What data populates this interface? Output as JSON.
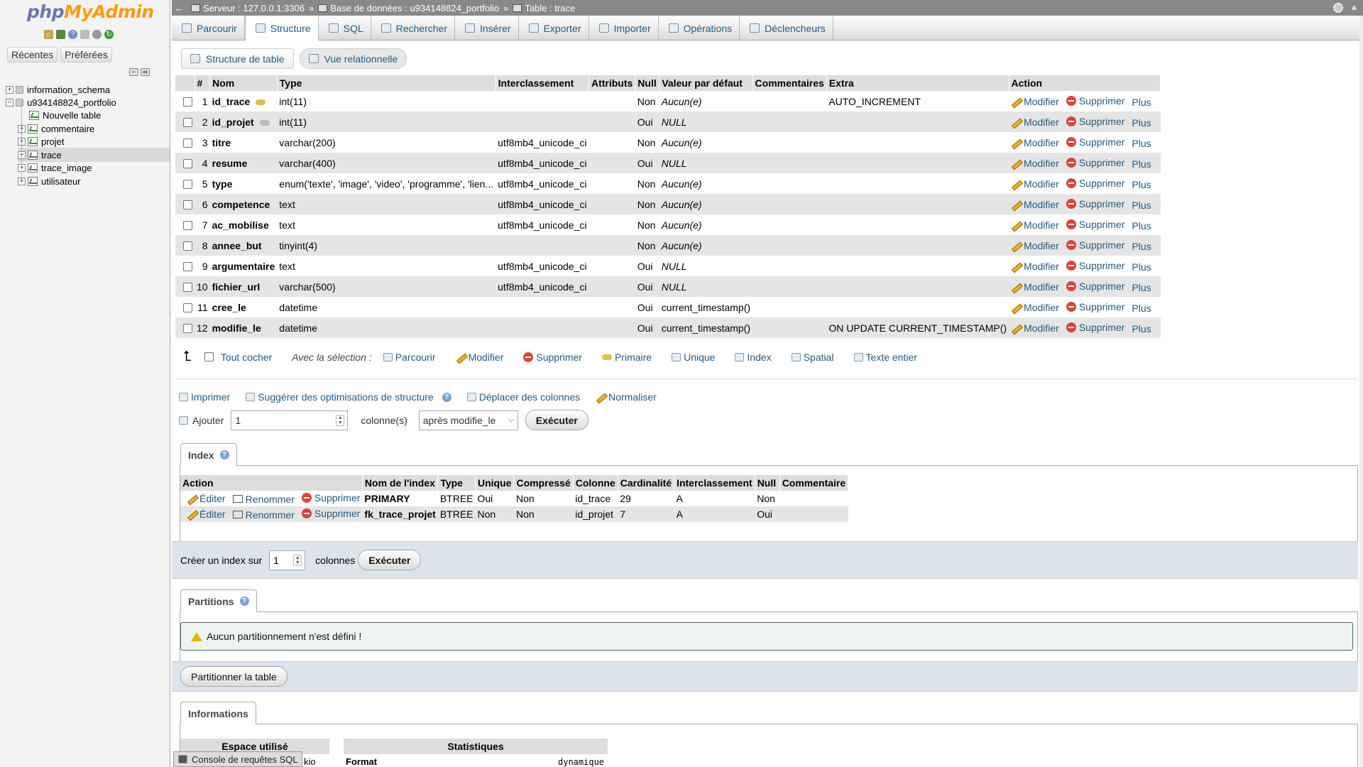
{
  "sidebar": {
    "logo_php": "php",
    "logo_my": "MyAdmin",
    "tabs": [
      "Récentes",
      "Préférées"
    ],
    "tree": [
      {
        "label": "information_schema",
        "kind": "db",
        "level": 0
      },
      {
        "label": "u934148824_portfolio",
        "kind": "db",
        "level": 0
      },
      {
        "label": "Nouvelle table",
        "kind": "new",
        "level": 1
      },
      {
        "label": "commentaire",
        "kind": "table",
        "level": 1
      },
      {
        "label": "projet",
        "kind": "table",
        "level": 1
      },
      {
        "label": "trace",
        "kind": "table",
        "level": 1
      },
      {
        "label": "trace_image",
        "kind": "table",
        "level": 1
      },
      {
        "label": "utilisateur",
        "kind": "table",
        "level": 1
      }
    ]
  },
  "breadcrumb": {
    "server": "Serveur : 127.0.0.1:3306",
    "database": "Base de données : u934148824_portfolio",
    "table": "Table : trace",
    "separator": "»"
  },
  "tabs": [
    "Parcourir",
    "Structure",
    "SQL",
    "Rechercher",
    "Insérer",
    "Exporter",
    "Importer",
    "Opérations",
    "Déclencheurs"
  ],
  "active_tab": "Structure",
  "subtabs": [
    "Structure de table",
    "Vue relationnelle"
  ],
  "structure": {
    "headers": [
      "#",
      "Nom",
      "Type",
      "Interclassement",
      "Attributs",
      "Null",
      "Valeur par défaut",
      "Commentaires",
      "Extra",
      "Action"
    ],
    "rows": [
      {
        "num": "1",
        "name": "id_trace",
        "key": "primary",
        "type": "int(11)",
        "collation": "",
        "null": "Non",
        "default": "Aucun(e)",
        "default_italic": true,
        "extra": "AUTO_INCREMENT"
      },
      {
        "num": "2",
        "name": "id_projet",
        "key": "index",
        "type": "int(11)",
        "collation": "",
        "null": "Oui",
        "default": "NULL",
        "default_italic": true,
        "extra": ""
      },
      {
        "num": "3",
        "name": "titre",
        "key": "",
        "type": "varchar(200)",
        "collation": "utf8mb4_unicode_ci",
        "null": "Non",
        "default": "Aucun(e)",
        "default_italic": true,
        "extra": ""
      },
      {
        "num": "4",
        "name": "resume",
        "key": "",
        "type": "varchar(400)",
        "collation": "utf8mb4_unicode_ci",
        "null": "Oui",
        "default": "NULL",
        "default_italic": true,
        "extra": ""
      },
      {
        "num": "5",
        "name": "type",
        "key": "",
        "type": "enum('texte', 'image', 'video', 'programme', 'lien...",
        "collation": "utf8mb4_unicode_ci",
        "null": "Non",
        "default": "Aucun(e)",
        "default_italic": true,
        "extra": ""
      },
      {
        "num": "6",
        "name": "competence",
        "key": "",
        "type": "text",
        "collation": "utf8mb4_unicode_ci",
        "null": "Non",
        "default": "Aucun(e)",
        "default_italic": true,
        "extra": ""
      },
      {
        "num": "7",
        "name": "ac_mobilise",
        "key": "",
        "type": "text",
        "collation": "utf8mb4_unicode_ci",
        "null": "Non",
        "default": "Aucun(e)",
        "default_italic": true,
        "extra": ""
      },
      {
        "num": "8",
        "name": "annee_but",
        "key": "",
        "type": "tinyint(4)",
        "collation": "",
        "null": "Non",
        "default": "Aucun(e)",
        "default_italic": true,
        "extra": ""
      },
      {
        "num": "9",
        "name": "argumentaire",
        "key": "",
        "type": "text",
        "collation": "utf8mb4_unicode_ci",
        "null": "Oui",
        "default": "NULL",
        "default_italic": true,
        "extra": ""
      },
      {
        "num": "10",
        "name": "fichier_url",
        "key": "",
        "type": "varchar(500)",
        "collation": "utf8mb4_unicode_ci",
        "null": "Oui",
        "default": "NULL",
        "default_italic": true,
        "extra": ""
      },
      {
        "num": "11",
        "name": "cree_le",
        "key": "",
        "type": "datetime",
        "collation": "",
        "null": "Oui",
        "default": "current_timestamp()",
        "default_italic": false,
        "extra": ""
      },
      {
        "num": "12",
        "name": "modifie_le",
        "key": "",
        "type": "datetime",
        "collation": "",
        "null": "Oui",
        "default": "current_timestamp()",
        "default_italic": false,
        "extra": "ON UPDATE CURRENT_TIMESTAMP()"
      }
    ],
    "actions": {
      "modify": "Modifier",
      "delete": "Supprimer",
      "more": "Plus"
    }
  },
  "selection": {
    "check_all": "Tout cocher",
    "with_selection": "Avec la sélection :",
    "actions": [
      "Parcourir",
      "Modifier",
      "Supprimer",
      "Primaire",
      "Unique",
      "Index",
      "Spatial",
      "Texte entier"
    ]
  },
  "tools": {
    "print": "Imprimer",
    "suggest": "Suggérer des optimisations de structure",
    "move": "Déplacer des colonnes",
    "normalize": "Normaliser"
  },
  "add": {
    "label": "Ajouter",
    "count": "1",
    "unit": "colonne(s)",
    "position": "après modifie_le",
    "execute": "Exécuter"
  },
  "index": {
    "legend": "Index",
    "headers": [
      "Action",
      "Nom de l'index",
      "Type",
      "Unique",
      "Compressé",
      "Colonne",
      "Cardinalité",
      "Interclassement",
      "Null",
      "Commentaire"
    ],
    "actions": {
      "edit": "Éditer",
      "rename": "Renommer",
      "delete": "Supprimer"
    },
    "rows": [
      {
        "name": "PRIMARY",
        "type": "BTREE",
        "unique": "Oui",
        "packed": "Non",
        "column": "id_trace",
        "cardinality": "29",
        "collation": "A",
        "null": "Non",
        "comment": ""
      },
      {
        "name": "fk_trace_projet",
        "type": "BTREE",
        "unique": "Non",
        "packed": "Non",
        "column": "id_projet",
        "cardinality": "7",
        "collation": "A",
        "null": "Oui",
        "comment": ""
      }
    ],
    "create_label": "Créer un index sur",
    "create_count": "1",
    "create_unit": "colonnes",
    "execute": "Exécuter"
  },
  "partitions": {
    "legend": "Partitions",
    "warning": "Aucun partitionnement n'est défini !",
    "button": "Partitionner la table"
  },
  "info": {
    "legend": "Informations",
    "space_header": "Espace utilisé",
    "stats_header": "Statistiques",
    "space_unit": "kio",
    "stats_format_label": "Format",
    "stats_format_value": "dynamique"
  },
  "console": "Console de requêtes SQL",
  "colors": {
    "link": "#235a81",
    "header_bg": "#dddddd",
    "topbar": "#888888",
    "logo_php": "#6c78af",
    "logo_my": "#f89c0e"
  }
}
